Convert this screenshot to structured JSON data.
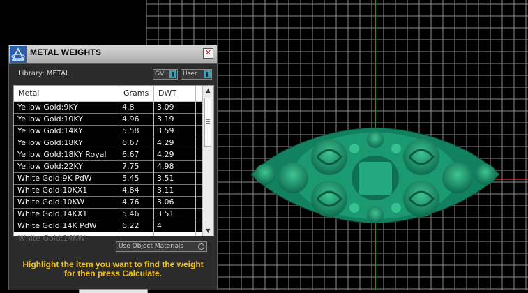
{
  "window": {
    "title": "METAL WEIGHTS",
    "close_glyph": "✕"
  },
  "library": {
    "label": "Library: METAL",
    "toggle_gv": "GV",
    "toggle_user": "User"
  },
  "table": {
    "columns": [
      "Metal",
      "Grams",
      "DWT"
    ],
    "rows": [
      {
        "metal": "Yellow Gold:9KY",
        "grams": "4.8",
        "dwt": "3.09"
      },
      {
        "metal": "Yellow Gold:10KY",
        "grams": "4.96",
        "dwt": "3.19"
      },
      {
        "metal": "Yellow Gold:14KY",
        "grams": "5.58",
        "dwt": "3.59"
      },
      {
        "metal": "Yellow Gold:18KY",
        "grams": "6.67",
        "dwt": "4.29"
      },
      {
        "metal": "Yellow Gold:18KY Royal",
        "grams": "6.67",
        "dwt": "4.29"
      },
      {
        "metal": "Yellow Gold:22KY",
        "grams": "7.75",
        "dwt": "4.98"
      },
      {
        "metal": "White Gold:9K PdW",
        "grams": "5.45",
        "dwt": "3.51"
      },
      {
        "metal": "White Gold:10KX1",
        "grams": "4.84",
        "dwt": "3.11"
      },
      {
        "metal": "White Gold:10KW",
        "grams": "4.76",
        "dwt": "3.06"
      },
      {
        "metal": "White Gold:14KX1",
        "grams": "5.46",
        "dwt": "3.51"
      },
      {
        "metal": "White Gold:14K PdW",
        "grams": "6.22",
        "dwt": "4"
      }
    ],
    "partial_row": "White Gold:14KW"
  },
  "use_object_materials": "Use Object Materials",
  "hint": {
    "line1": "Highlight the item you want to find the weight",
    "line2": "for then press Calculate."
  },
  "colors": {
    "model": "#1f9a72",
    "hint": "#f2c21c",
    "toggle_knob": "#3da2b4"
  },
  "icons": {
    "logo": "app-logo-icon",
    "close": "close-icon",
    "scroll_up": "scroll-up-arrow-icon",
    "scroll_down": "scroll-down-arrow-icon"
  }
}
